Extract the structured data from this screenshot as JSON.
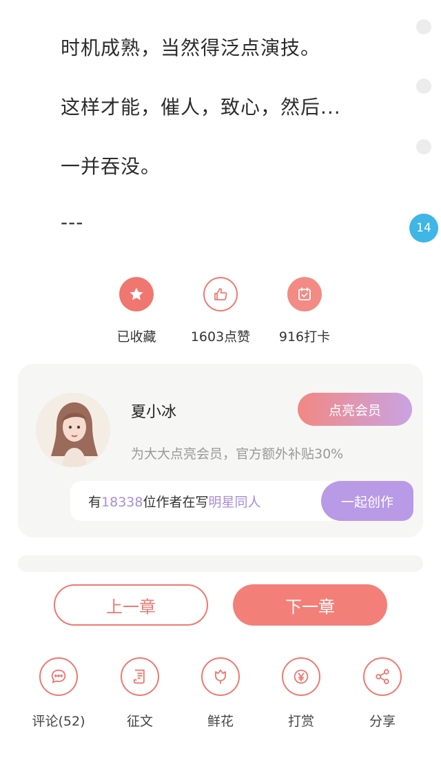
{
  "content": {
    "paragraphs": [
      "时机成熟，当然得泛点演技。",
      "这样才能，催人，致心，然后...",
      "一并吞没。",
      "---"
    ]
  },
  "side": {
    "badge_count": "14"
  },
  "actions": [
    {
      "label": "已收藏",
      "icon": "star-icon"
    },
    {
      "label": "1603点赞",
      "icon": "thumbs-up-icon"
    },
    {
      "label": "916打卡",
      "icon": "checkin-icon"
    }
  ],
  "author_card": {
    "name": "夏小冰",
    "vip_button": "点亮会员",
    "vip_subtitle": "为大大点亮会员，官方额外补贴30%",
    "writer_prefix": "有",
    "writer_count": "18338",
    "writer_middle": "位作者在写",
    "writer_topic": "明星同人",
    "write_button": "一起创作"
  },
  "nav": {
    "prev": "上一章",
    "next": "下一章"
  },
  "toolbar": [
    {
      "label": "评论(52)",
      "icon": "comment-icon"
    },
    {
      "label": "征文",
      "icon": "essay-icon"
    },
    {
      "label": "鲜花",
      "icon": "flower-icon"
    },
    {
      "label": "打赏",
      "icon": "reward-icon"
    },
    {
      "label": "分享",
      "icon": "share-icon"
    }
  ],
  "colors": {
    "accent": "#f0776f",
    "purple": "#b89ae6",
    "badge": "#3fb6e6"
  }
}
